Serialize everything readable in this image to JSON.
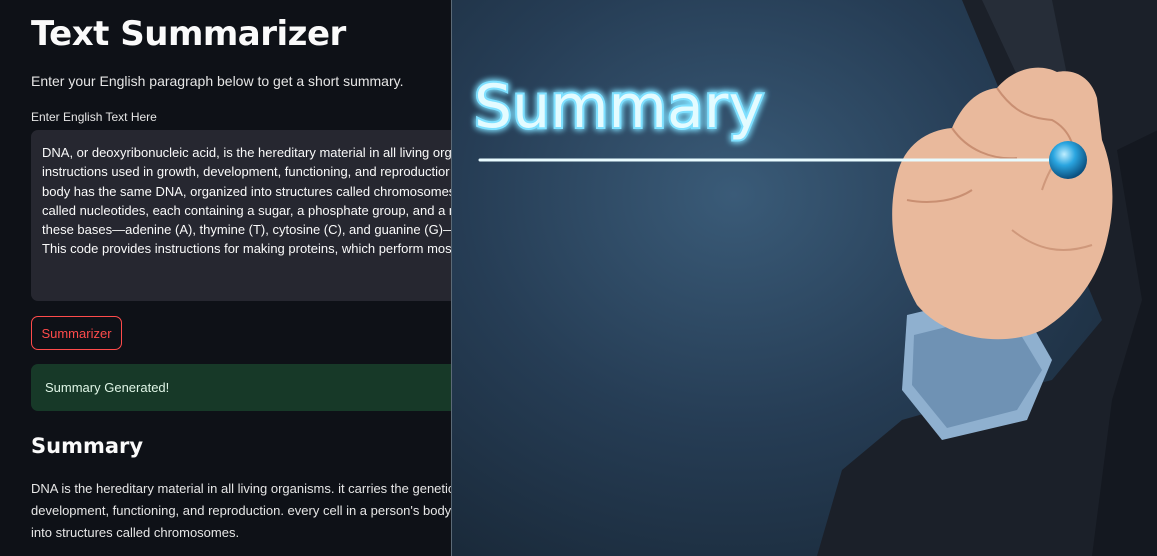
{
  "app": {
    "title": "Text Summarizer",
    "subtitle": "Enter your English paragraph below to get a short summary."
  },
  "input": {
    "label": "Enter English Text Here",
    "value_lines": [
      "DNA, or deoxyribonucleic acid, is the hereditary material in all living orga",
      "instructions used in growth, development, functioning, and reproductior",
      "body has the same DNA, organized into structures called chromosomes. I",
      "called nucleotides, each containing a sugar, a phosphate group, and a nit",
      "these bases—adenine (A), thymine (T), cytosine (C), and guanine (G)—det",
      "This code provides instructions for making proteins, which perform most"
    ]
  },
  "button": {
    "label": "Summarizer"
  },
  "alert": {
    "text": "Summary Generated!"
  },
  "summary": {
    "heading": "Summary",
    "lines": [
      "DNA is the hereditary material in all living organisms. it carries the genetic i",
      "development, functioning, and reproduction. every cell in a person's body",
      "into structures called chromosomes."
    ]
  },
  "hero_image": {
    "word": "Summary",
    "colors": {
      "glow": "#8fe4ff",
      "line": "#e8fbff",
      "marker": "#27a6e0",
      "suit": "#1c2330"
    }
  },
  "colors": {
    "background": "#0e1117",
    "input_bg": "#262730",
    "accent": "#ff4b4b",
    "success_bg": "#173928"
  }
}
